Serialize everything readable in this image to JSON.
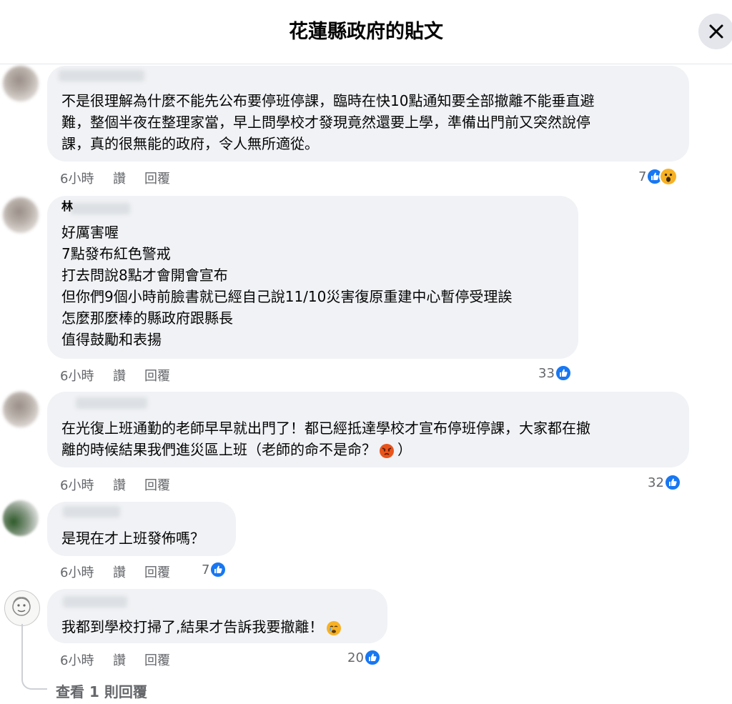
{
  "header": {
    "title": "花蓮縣政府的貼文"
  },
  "actions": {
    "time": "6小時",
    "like": "讚",
    "reply": "回覆"
  },
  "comments": [
    {
      "text": "不是很理解為什麼不能先公布要停班停課，臨時在快10點通知要全部撤離不能垂直避\n難，整個半夜在整理家當，早上問學校才發現竟然還要上學，準備出門前又突然說停\n課，真的很無能的政府，令人無所適從。",
      "reactions": "7"
    },
    {
      "name_visible": "林",
      "text": "好厲害喔\n7點發布紅色警戒\n打去問說8點才會開會宣布\n但你們9個小時前臉書就已經自己說11/10災害復原重建中心暫停受理誒\n怎麼那麼棒的縣政府跟縣長\n值得鼓勵和表揚",
      "reactions": "33"
    },
    {
      "text": "在光復上班通勤的老師早早就出門了！都已經抵達學校才宣布停班停課，大家都在撤\n離的時候結果我們進災區上班（老師的命不是命？",
      "text_end": "）",
      "reactions": "32"
    },
    {
      "text": "是現在才上班發佈嗎？",
      "reactions": "7"
    },
    {
      "text": "我都到學校打掃了,結果才告訴我要撤離！",
      "reactions": "20"
    }
  ],
  "view_replies": "查看 1 則回覆",
  "colors": {
    "like_blue": "#1877f2",
    "bubble_bg": "#f0f2f5",
    "meta_text": "#65676b"
  }
}
